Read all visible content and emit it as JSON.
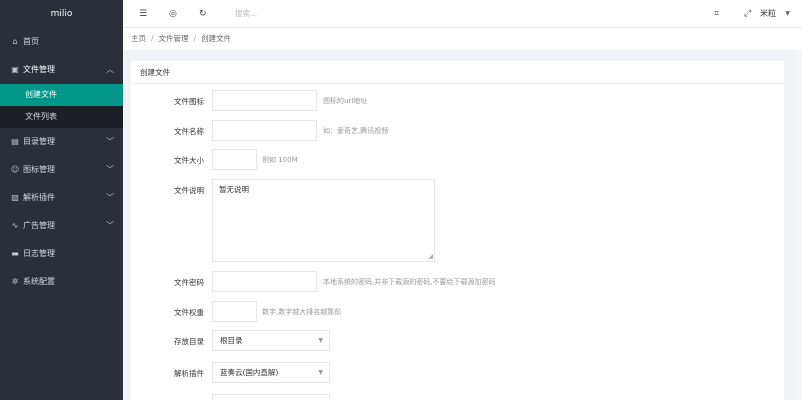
{
  "app": {
    "logo": "milio"
  },
  "sidebar": {
    "items": [
      {
        "label": "首页",
        "icon": "home-icon",
        "glyph": "⌂"
      },
      {
        "label": "文件管理",
        "icon": "file-icon",
        "glyph": "▣",
        "open": true,
        "children": [
          {
            "label": "创建文件",
            "active": true
          },
          {
            "label": "文件列表"
          }
        ]
      },
      {
        "label": "目录管理",
        "icon": "folder-icon",
        "glyph": "▤"
      },
      {
        "label": "图标管理",
        "icon": "smile-icon",
        "glyph": "☺"
      },
      {
        "label": "解析插件",
        "icon": "plugin-icon",
        "glyph": "▨"
      },
      {
        "label": "广告管理",
        "icon": "pulse-icon",
        "glyph": "∿"
      },
      {
        "label": "日志管理",
        "icon": "log-icon",
        "glyph": "▬"
      },
      {
        "label": "系统配置",
        "icon": "gear-icon",
        "glyph": "✲"
      }
    ]
  },
  "header": {
    "search_placeholder": "搜索...",
    "user": "米粒"
  },
  "breadcrumb": [
    "主页",
    "文件管理",
    "创建文件"
  ],
  "form": {
    "title": "创建文件",
    "icon_label": "文件图标",
    "icon_hint": "图标的url地址",
    "name_label": "文件名称",
    "name_hint": "如：爱奇艺,腾讯视频",
    "size_label": "文件大小",
    "size_hint": "例如 100M",
    "desc_label": "文件说明",
    "desc_value": "暂无说明",
    "password_label": "文件密码",
    "password_hint": "本地系统的密码,并非下载源的密码,不要给下载源加密码",
    "weight_label": "文件权重",
    "weight_hint": "数字,数字越大排名越靠前",
    "dir_label": "存放目录",
    "dir_value": "根目录",
    "plugin_label": "解析插件",
    "plugin_value": "蓝奏云(国内直解)"
  }
}
